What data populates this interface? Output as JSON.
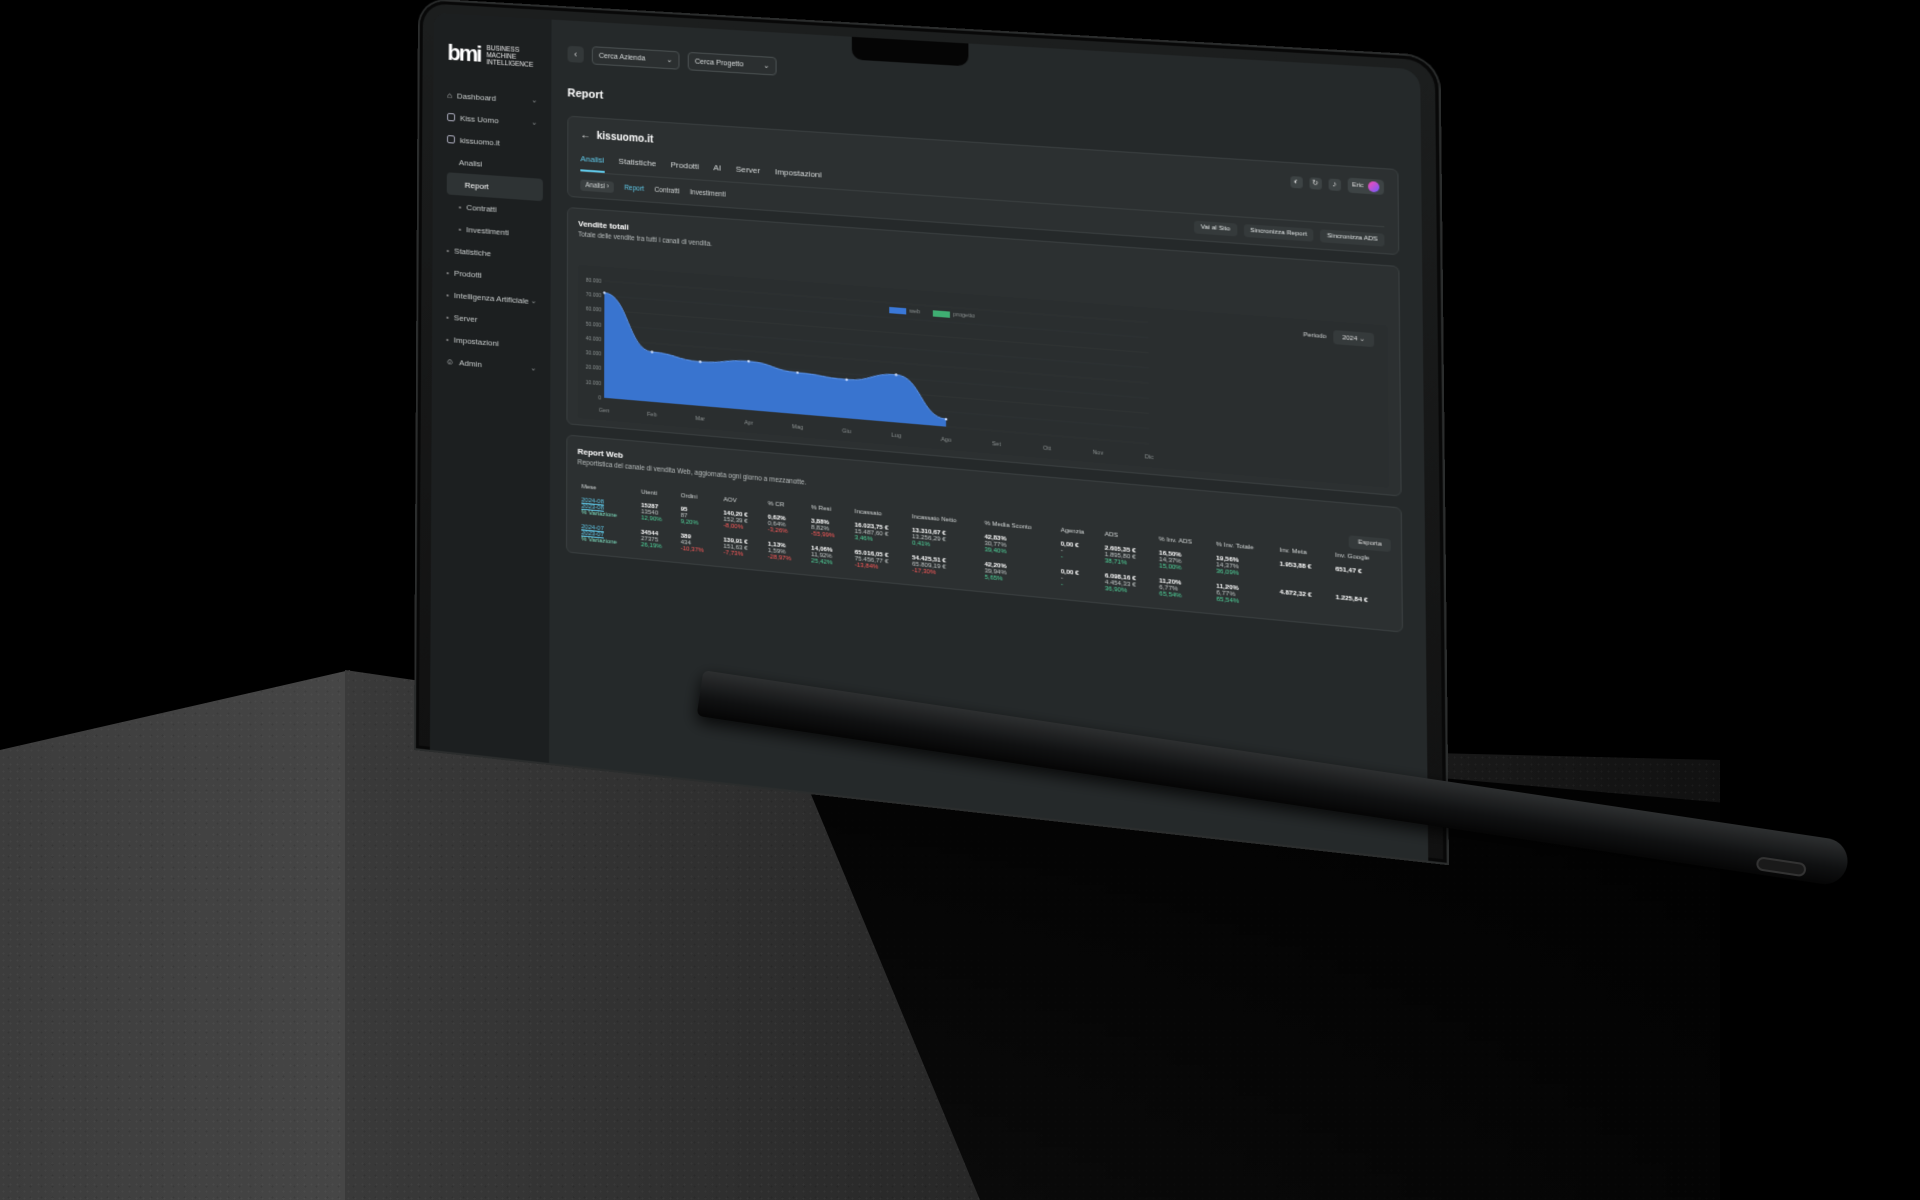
{
  "logo": {
    "mark": "bmi",
    "line1": "BUSINESS",
    "line2": "MACHINE",
    "line3": "INTELLIGENCE"
  },
  "sidebar": {
    "items": [
      {
        "label": "Dashboard",
        "icon": "home-icon"
      },
      {
        "label": "Kiss Uomo",
        "icon": "building-icon"
      },
      {
        "label": "kissuomo.it",
        "icon": "folder-icon"
      },
      {
        "label": "Analisi"
      },
      {
        "label": "Report"
      },
      {
        "label": "Contratti"
      },
      {
        "label": "Investimenti"
      },
      {
        "label": "Statistiche"
      },
      {
        "label": "Prodotti"
      },
      {
        "label": "Intelligenza Artificiale"
      },
      {
        "label": "Server"
      },
      {
        "label": "Impostazioni"
      },
      {
        "label": "Admin",
        "icon": "user-icon"
      }
    ]
  },
  "topbar": {
    "company_select": "Cerca Azienda",
    "project_select": "Cerca Progetto"
  },
  "page_title": "Report",
  "project": {
    "name": "kissuomo.it",
    "user": "Eric",
    "tabs": [
      "Analisi",
      "Statistiche",
      "Prodotti",
      "AI",
      "Server",
      "Impostazioni"
    ],
    "subtabs": {
      "crumb": "Analisi",
      "items": [
        "Report",
        "Contratti",
        "Investimenti"
      ]
    },
    "actions": [
      "Vai al Sito",
      "Sincronizza Report",
      "Sincronizza ADS"
    ]
  },
  "sales": {
    "title": "Vendite totali",
    "subtitle": "Totale delle vendite tra tutti i canali di vendita.",
    "period_label": "Periodo",
    "period_value": "2024"
  },
  "chart_data": {
    "type": "area",
    "x": [
      "Gen",
      "Feb",
      "Mar",
      "Apr",
      "Mag",
      "Giu",
      "Lug",
      "Ago",
      "Set",
      "Ott",
      "Nov",
      "Dic"
    ],
    "series": [
      {
        "name": "web",
        "values": [
          72000,
          34000,
          30000,
          33000,
          28000,
          26000,
          32000,
          5000,
          null,
          null,
          null,
          null
        ],
        "color": "#3a78d8"
      },
      {
        "name": "progetto",
        "values": [],
        "color": "#3fae72"
      }
    ],
    "yticks": [
      "80.000",
      "70.000",
      "60.000",
      "50.000",
      "40.000",
      "30.000",
      "20.000",
      "10.000",
      "0"
    ],
    "ylim": [
      0,
      80000
    ],
    "legend": "top-center",
    "grid": true
  },
  "report": {
    "title": "Report Web",
    "subtitle": "Reportistica del canale di vendita Web, aggiornata ogni giorno a mezzanotte.",
    "export": "Esporta",
    "columns": [
      "Mese",
      "Utenti",
      "Ordini",
      "AOV",
      "% CR",
      "% Resi",
      "Incassato",
      "Incassato Netto",
      "% Media Sconto",
      "Agenzia",
      "ADS",
      "% Inv. ADS",
      "% Inv. Totale",
      "Inv. Meta",
      "Inv. Google"
    ],
    "rows": [
      {
        "m1": "2024-08",
        "m2": "2023-08",
        "var": "% Variazione",
        "cells": [
          [
            "15287",
            "13540",
            "12,90%",
            "pos"
          ],
          [
            "95",
            "87",
            "9,20%",
            "pos"
          ],
          [
            "140,20 €",
            "152,39 €",
            "-8,00%",
            "neg"
          ],
          [
            "0,62%",
            "0,64%",
            "-3,26%",
            "neg"
          ],
          [
            "3,88%",
            "8,82%",
            "-55,99%",
            "neg"
          ],
          [
            "16.023,75 €",
            "15.487,60 €",
            "3,46%",
            "pos"
          ],
          [
            "13.310,67 €",
            "13.256,29 €",
            "0,41%",
            "pos"
          ],
          [
            "42,83%",
            "30,77%",
            "39,40%",
            "pos"
          ],
          [
            "0,00 €",
            "-",
            "-",
            "pos"
          ],
          [
            "2.605,35 €",
            "1.895,80 €",
            "38,71%",
            "pos"
          ],
          [
            "16,50%",
            "14,37%",
            "15,00%",
            "pos"
          ],
          [
            "19,56%",
            "14,37%",
            "36,09%",
            "pos"
          ],
          [
            "1.953,88 €",
            "",
            "",
            "pos"
          ],
          [
            "651,47 €",
            "",
            "",
            "pos"
          ]
        ]
      },
      {
        "m1": "2024-07",
        "m2": "2023-07",
        "var": "% Variazione",
        "cells": [
          [
            "34544",
            "27375",
            "26,19%",
            "pos"
          ],
          [
            "389",
            "434",
            "-10,37%",
            "neg"
          ],
          [
            "139,91 €",
            "151,63 €",
            "-7,73%",
            "neg"
          ],
          [
            "1,13%",
            "1,59%",
            "-28,97%",
            "neg"
          ],
          [
            "14,06%",
            "11,92%",
            "25,42%",
            "pos"
          ],
          [
            "65.016,05 €",
            "75.456,77 €",
            "-13,84%",
            "neg"
          ],
          [
            "54.425,51 €",
            "65.809,19 €",
            "-17,30%",
            "neg"
          ],
          [
            "42,20%",
            "39,94%",
            "5,65%",
            "pos"
          ],
          [
            "0,00 €",
            "-",
            "-",
            "pos"
          ],
          [
            "6.098,16 €",
            "4.454,33 €",
            "36,90%",
            "pos"
          ],
          [
            "11,20%",
            "6,77%",
            "65,54%",
            "pos"
          ],
          [
            "11,20%",
            "6,77%",
            "65,54%",
            "pos"
          ],
          [
            "4.872,32 €",
            "",
            "",
            "pos"
          ],
          [
            "1.225,84 €",
            "",
            "",
            "pos"
          ]
        ]
      }
    ]
  },
  "colors": {
    "accent": "#5fc8e8",
    "area": "#3a78d8",
    "positive": "#4fd39a",
    "negative": "#ff5a5a"
  }
}
